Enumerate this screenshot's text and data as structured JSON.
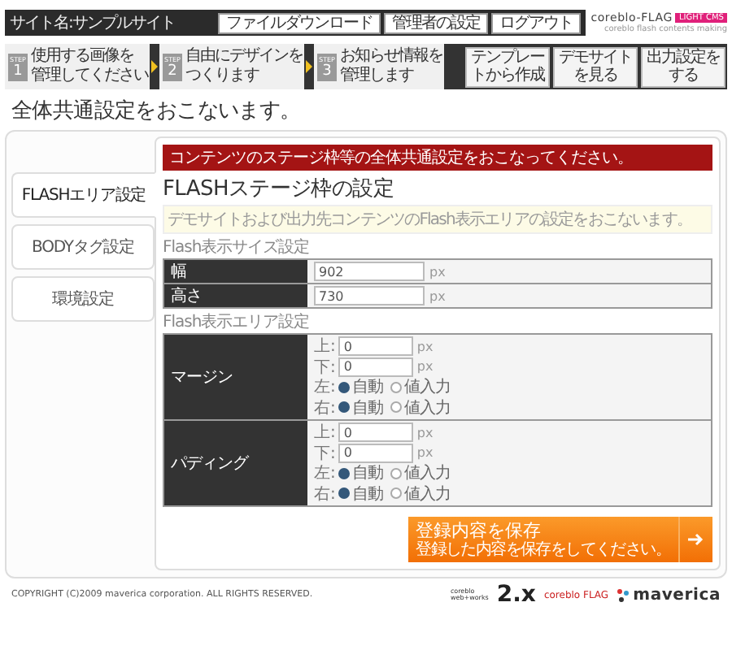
{
  "header": {
    "site_name": "サイト名:サンプルサイト",
    "buttons": [
      "ファイルダウンロード",
      "管理者の設定",
      "ログアウト"
    ],
    "logo": {
      "name": "coreblo-FLAG",
      "badge": "LIGHT CMS",
      "tagline": "coreblo flash contents making"
    }
  },
  "steps": [
    {
      "badge": "STEP",
      "number": "1",
      "lines": [
        "使用する画像を",
        "管理してください"
      ]
    },
    {
      "badge": "STEP",
      "number": "2",
      "lines": [
        "自由にデザインを",
        "つくります"
      ]
    },
    {
      "badge": "STEP",
      "number": "3",
      "lines": [
        "お知らせ情報を",
        "管理します"
      ]
    }
  ],
  "actions": [
    "テンプレートから作成",
    "デモサイトを見る",
    "出力設定をする"
  ],
  "page_title": "全体共通設定をおこないます。",
  "sidebar": [
    {
      "label": "FLASHエリア設定",
      "selected": true
    },
    {
      "label": "BODYタグ設定",
      "selected": false
    },
    {
      "label": "環境設定",
      "selected": false
    }
  ],
  "banner": "コンテンツのステージ枠等の全体共通設定をおこなってください。",
  "heading": "FLASHステージ枠の設定",
  "note": "デモサイトおよび出力先コンテンツのFlash表示エリアの設定をおこないます。",
  "size_section": {
    "label": "Flash表示サイズ設定",
    "rows": [
      {
        "label": "幅",
        "value": "902",
        "unit": "px"
      },
      {
        "label": "高さ",
        "value": "730",
        "unit": "px"
      }
    ]
  },
  "area_section": {
    "label": "Flash表示エリア設定",
    "groups": [
      {
        "label": "マージン",
        "fields": [
          {
            "kind": "input",
            "label": "上:",
            "value": "0",
            "unit": "px"
          },
          {
            "kind": "input",
            "label": "下:",
            "value": "0",
            "unit": "px"
          },
          {
            "kind": "radio",
            "label": "左:",
            "options": [
              {
                "label": "自動",
                "selected": true
              },
              {
                "label": "値入力",
                "selected": false
              }
            ]
          },
          {
            "kind": "radio",
            "label": "右:",
            "options": [
              {
                "label": "自動",
                "selected": true
              },
              {
                "label": "値入力",
                "selected": false
              }
            ]
          }
        ]
      },
      {
        "label": "パディング",
        "fields": [
          {
            "kind": "input",
            "label": "上:",
            "value": "0",
            "unit": "px"
          },
          {
            "kind": "input",
            "label": "下:",
            "value": "0",
            "unit": "px"
          },
          {
            "kind": "radio",
            "label": "左:",
            "options": [
              {
                "label": "自動",
                "selected": true
              },
              {
                "label": "値入力",
                "selected": false
              }
            ]
          },
          {
            "kind": "radio",
            "label": "右:",
            "options": [
              {
                "label": "自動",
                "selected": true
              },
              {
                "label": "値入力",
                "selected": false
              }
            ]
          }
        ]
      }
    ]
  },
  "save_button": {
    "label": "登録内容を保存",
    "sub": "登録した内容を保存をしてください。"
  },
  "footer": {
    "copyright": "COPYRIGHT (C)2009 maverica corporation. ALL RIGHTS RESERVED.",
    "logos": [
      {
        "kind": "stack",
        "lines": [
          "coreblo",
          "web+works"
        ]
      },
      {
        "kind": "big",
        "text": "2.x"
      },
      {
        "kind": "flag",
        "text": "coreblo FLAG"
      },
      {
        "kind": "brand",
        "text": "maverica"
      }
    ]
  }
}
